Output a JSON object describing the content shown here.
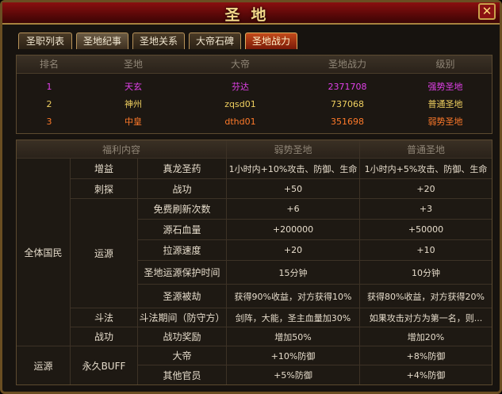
{
  "window": {
    "title": "圣地",
    "close_glyph": "✕"
  },
  "tabs": [
    "圣职列表",
    "圣地纪事",
    "圣地关系",
    "大帝石碑",
    "圣地战力"
  ],
  "ranking": {
    "headers": [
      "排名",
      "圣地",
      "大帝",
      "圣地战力",
      "级别"
    ],
    "rows": [
      {
        "rank": "1",
        "name": "天玄",
        "emperor": "芬达",
        "power": "2371708",
        "level": "强势圣地",
        "color": "#e040e8"
      },
      {
        "rank": "2",
        "name": "神州",
        "emperor": "zqsd01",
        "power": "737068",
        "level": "普通圣地",
        "color": "#f0d060"
      },
      {
        "rank": "3",
        "name": "中皇",
        "emperor": "dthd01",
        "power": "351698",
        "level": "弱势圣地",
        "color": "#ff7a2a"
      }
    ]
  },
  "benefits": {
    "header": {
      "content": "福利内容",
      "weak": "弱势圣地",
      "normal": "普通圣地"
    },
    "groups": {
      "all_citizens": "全体国民",
      "yunyuan": "运源"
    },
    "cats": {
      "zengyi": "增益",
      "citan": "刺探",
      "yunyuan": "运源",
      "doufa": "斗法",
      "zhangong": "战功",
      "yongjiu": "永久BUFF"
    },
    "rows": [
      {
        "item": "真龙圣药",
        "weak": "1小时内+10%攻击、防御、生命",
        "normal": "1小时内+5%攻击、防御、生命"
      },
      {
        "item": "战功",
        "weak": "+50",
        "normal": "+20"
      },
      {
        "item": "免费刷新次数",
        "weak": "+6",
        "normal": "+3"
      },
      {
        "item": "源石血量",
        "weak": "+200000",
        "normal": "+50000"
      },
      {
        "item": "拉源速度",
        "weak": "+20",
        "normal": "+10"
      },
      {
        "item": "圣地运源保护时间",
        "weak": "15分钟",
        "normal": "10分钟"
      },
      {
        "item": "圣源被劫",
        "weak": "获得90%收益，对方获得10%",
        "normal": "获得80%收益，对方获得20%"
      },
      {
        "item": "斗法期间（防守方）",
        "weak": "剑阵，大能，圣主血量加30%",
        "normal": "如果攻击对方为第一名，则..."
      },
      {
        "item": "战功奖励",
        "weak": "增加50%",
        "normal": "增加20%"
      },
      {
        "item": "大帝",
        "weak": "+10%防御",
        "normal": "+8%防御"
      },
      {
        "item": "其他官员",
        "weak": "+5%防御",
        "normal": "+4%防御"
      }
    ]
  },
  "colors": {
    "frame": "#6a4e22",
    "title_bar": "#8a1010",
    "active_tab": "#c24a1a",
    "text": "#e6dccb"
  }
}
